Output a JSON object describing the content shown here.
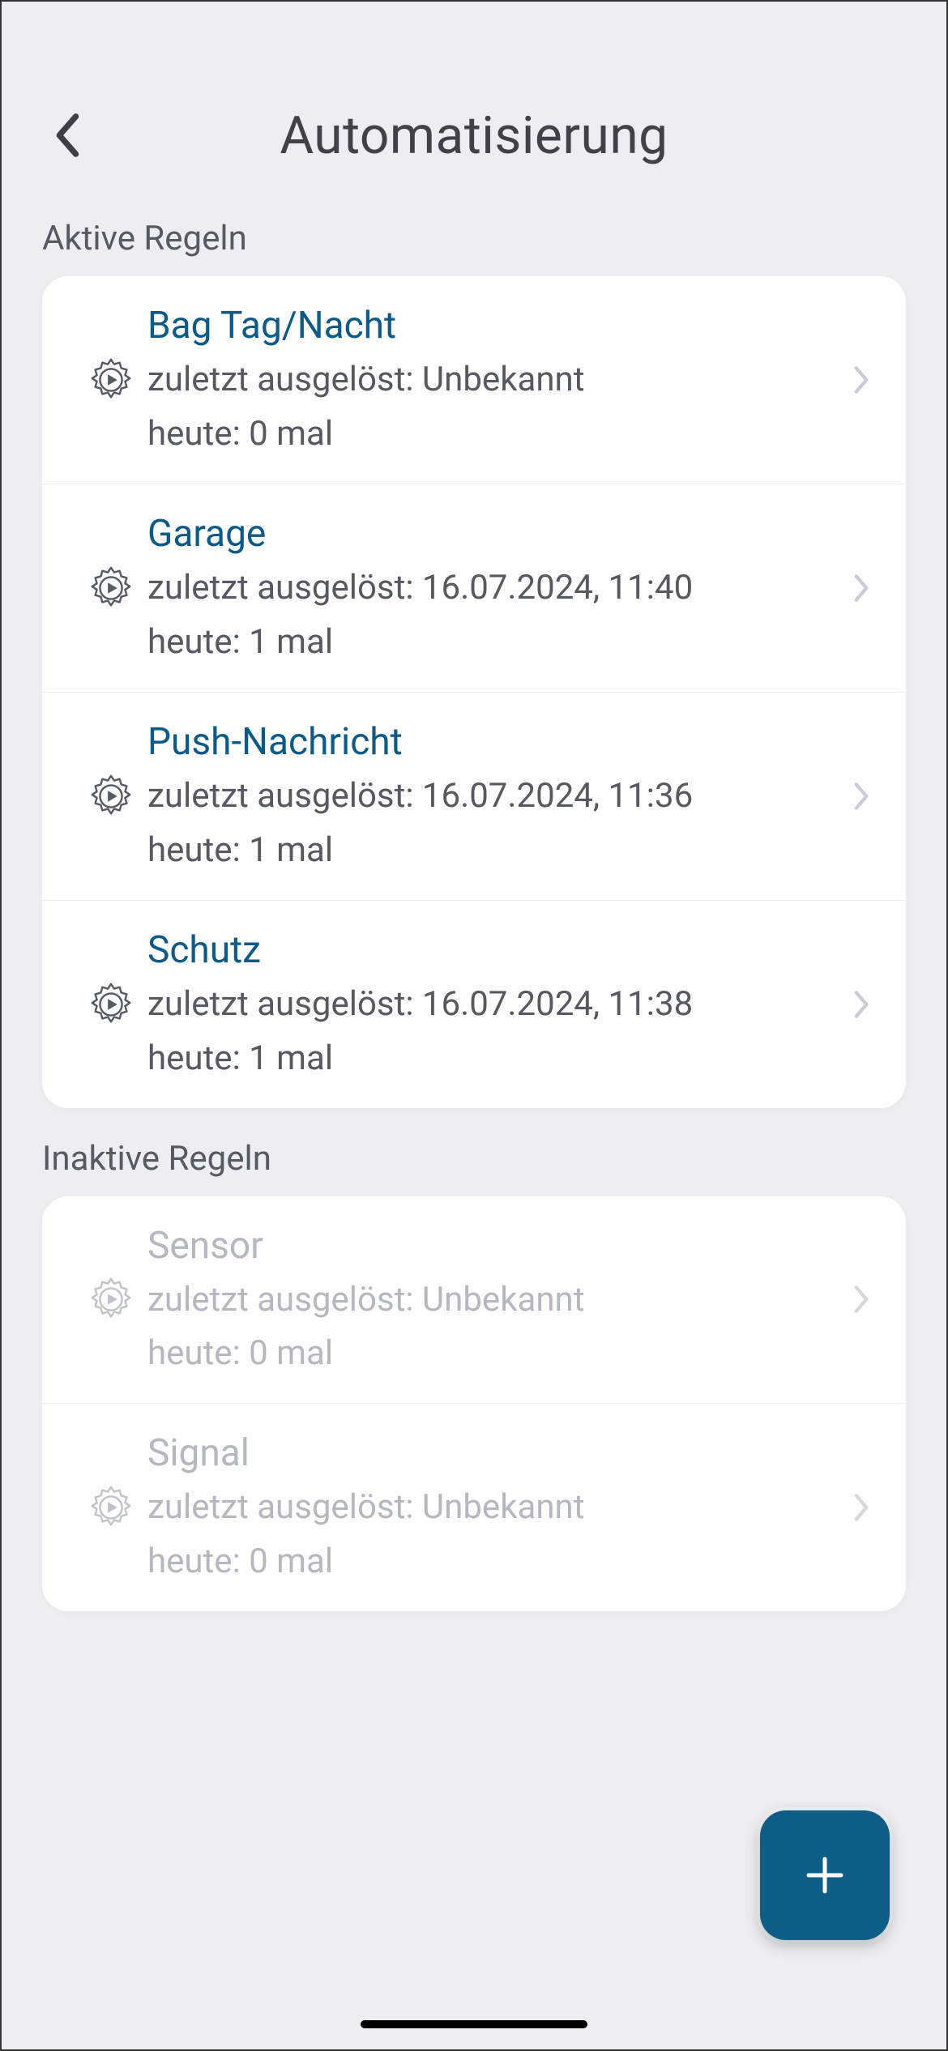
{
  "header": {
    "title": "Automatisierung"
  },
  "sections": {
    "active_label": "Aktive Regeln",
    "inactive_label": "Inaktive Regeln"
  },
  "active_rules": [
    {
      "title": "Bag Tag/Nacht",
      "last": "zuletzt ausgelöst: Unbekannt",
      "today": "heute: 0 mal"
    },
    {
      "title": "Garage",
      "last": "zuletzt ausgelöst: 16.07.2024, 11:40",
      "today": "heute: 1 mal"
    },
    {
      "title": "Push-Nachricht",
      "last": "zuletzt ausgelöst: 16.07.2024, 11:36",
      "today": "heute: 1 mal"
    },
    {
      "title": "Schutz",
      "last": "zuletzt ausgelöst: 16.07.2024, 11:38",
      "today": "heute: 1 mal"
    }
  ],
  "inactive_rules": [
    {
      "title": "Sensor",
      "last": "zuletzt ausgelöst: Unbekannt",
      "today": "heute: 0 mal"
    },
    {
      "title": "Signal",
      "last": "zuletzt ausgelöst: Unbekannt",
      "today": "heute: 0 mal"
    }
  ]
}
